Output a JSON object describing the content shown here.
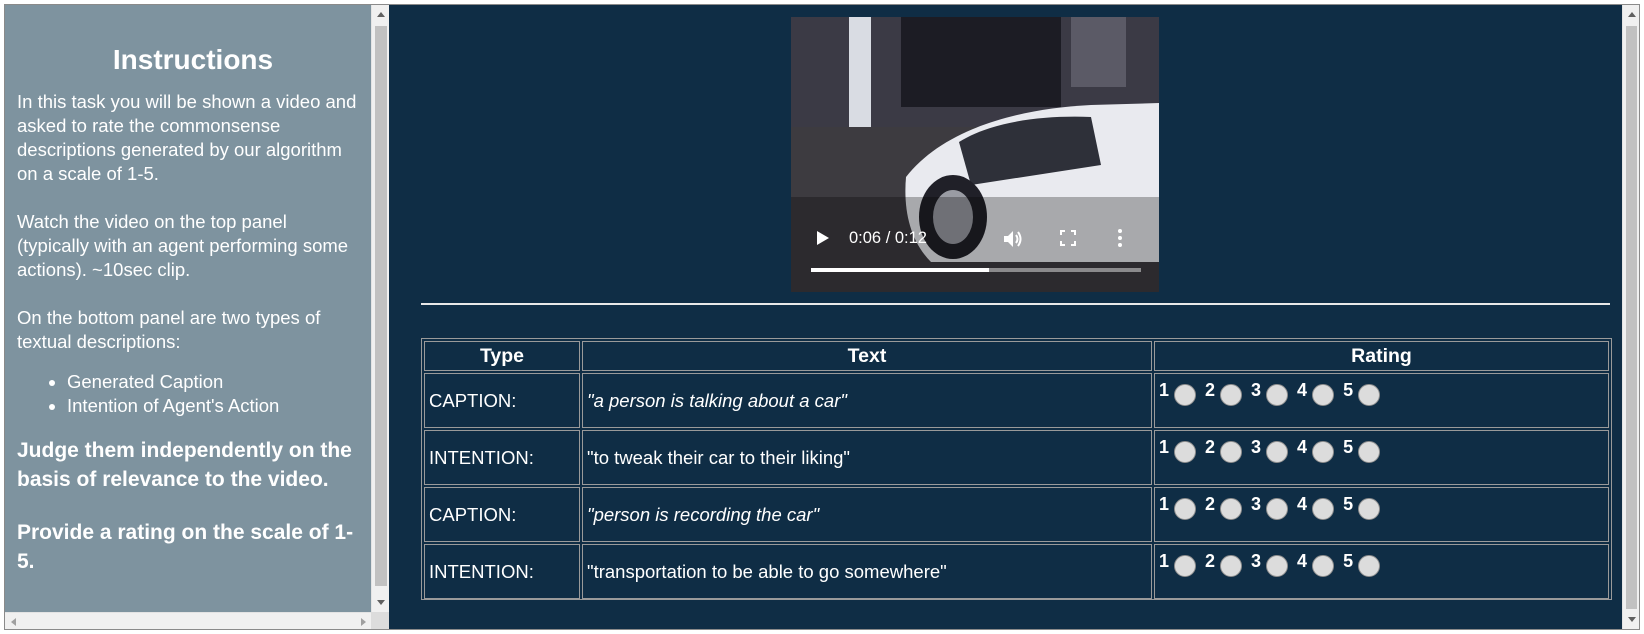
{
  "instructions": {
    "title": "Instructions",
    "para1": "In this task you will be shown a video and asked to rate the commonsense descriptions generated by our algorithm on a scale of 1-5.",
    "para2": "Watch the video on the top panel (typically with an agent performing some actions). ~10sec clip.",
    "para3": "On the bottom panel are two types of textual descriptions:",
    "list": [
      "Generated Caption",
      "Intention of Agent's Action"
    ],
    "bold1": "Judge them independently on the basis of relevance to the video.",
    "bold2": "Provide a rating on the scale of 1-5."
  },
  "video": {
    "time": "0:06 / 0:12",
    "progress_fraction": 0.54,
    "icons": [
      "play-icon",
      "volume-icon",
      "fullscreen-icon",
      "more-options-icon"
    ]
  },
  "table": {
    "headers": [
      "Type",
      "Text",
      "Rating"
    ],
    "rows": [
      {
        "type": "CAPTION:",
        "text": "\"a person is talking about a car\"",
        "italic": true
      },
      {
        "type": "INTENTION:",
        "text": "\"to tweak their car to their liking\"",
        "italic": false
      },
      {
        "type": "CAPTION:",
        "text": "\"person is recording the car\"",
        "italic": true
      },
      {
        "type": "INTENTION:",
        "text": "\"transportation to be able to go somewhere\"",
        "italic": false
      }
    ],
    "rating_labels": [
      "1",
      "2",
      "3",
      "4",
      "5"
    ]
  },
  "colors": {
    "left_bg": "#7e939f",
    "right_bg": "#0f2d45",
    "text": "#ffffff",
    "radio": "#dcdcdc"
  }
}
